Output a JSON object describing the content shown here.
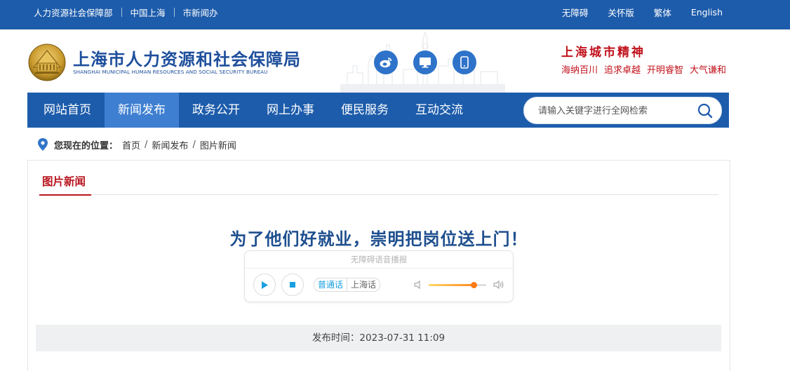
{
  "topbar": {
    "links": [
      "人力资源社会保障部",
      "中国上海",
      "市新闻办"
    ],
    "right": [
      "无障碍",
      "关怀版",
      "繁体",
      "English"
    ],
    "bg": "#1d5cab"
  },
  "header": {
    "title_cn": "上海市人力资源和社会保障局",
    "title_en": "SHANGHAI MUNICIPAL HUMAN RESOURCES AND SOCIAL SECURITY BUREAU",
    "social_icons": [
      "weibo-icon",
      "desktop-icon",
      "mobile-icon"
    ],
    "slogan_title": "上海城市精神",
    "slogan_items": [
      "海纳百川",
      "追求卓越",
      "开明睿智",
      "大气谦和"
    ]
  },
  "nav": {
    "items": [
      {
        "label": "网站首页",
        "active": false
      },
      {
        "label": "新闻发布",
        "active": true
      },
      {
        "label": "政务公开",
        "active": false
      },
      {
        "label": "网上办事",
        "active": false
      },
      {
        "label": "便民服务",
        "active": false
      },
      {
        "label": "互动交流",
        "active": false
      }
    ],
    "search_placeholder": "请输入关键字进行全网检索"
  },
  "breadcrumb": {
    "label": "您现在的位置：",
    "items": [
      "首页",
      "新闻发布",
      "图片新闻"
    ]
  },
  "content": {
    "tab_title": "图片新闻",
    "article_title": "为了他们好就业，崇明把岗位送上门！",
    "player": {
      "header": "无障碍语音播报",
      "lang_selected": "普通话",
      "lang_other": "上海话",
      "volume": 0.78
    },
    "publish": "发布时间：2023-07-31 11:09"
  },
  "colors": {
    "primary": "#1d5cab",
    "nav_active": "#3e7fd1",
    "accent_red": "#c0121b",
    "title_blue": "#1e4f8e"
  }
}
